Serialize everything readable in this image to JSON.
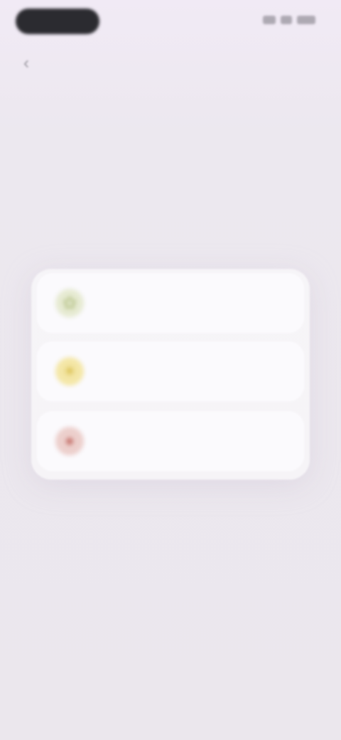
{
  "status": {
    "icons": [
      "signal-icon",
      "wifi-icon",
      "battery-icon"
    ]
  },
  "nav": {
    "back_glyph": "‹"
  },
  "screen": {
    "title": "",
    "options": [
      {
        "label": "",
        "icon": "sprout-icon",
        "glyph": "✿",
        "color": "#b8c48a"
      },
      {
        "label": "",
        "icon": "sun-icon",
        "glyph": "☀",
        "color": "#d8bd4a"
      },
      {
        "label": "",
        "icon": "flame-icon",
        "glyph": "●",
        "color": "#c97a74"
      }
    ]
  }
}
